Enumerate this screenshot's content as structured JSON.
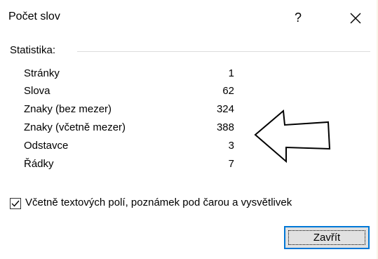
{
  "dialog": {
    "title": "Počet slov",
    "help_label": "?",
    "close_icon": "close-icon"
  },
  "statistics": {
    "group_label": "Statistika:",
    "rows": [
      {
        "label": "Stránky",
        "value": "1"
      },
      {
        "label": "Slova",
        "value": "62"
      },
      {
        "label": "Znaky (bez mezer)",
        "value": "324"
      },
      {
        "label": "Znaky (včetně mezer)",
        "value": "388"
      },
      {
        "label": "Odstavce",
        "value": "3"
      },
      {
        "label": "Řádky",
        "value": "7"
      }
    ]
  },
  "annotation": {
    "icon": "left-arrow-icon"
  },
  "options": {
    "include_label": "Včetně textových polí, poznámek pod čarou a vysvětlivek",
    "include_checked": true
  },
  "buttons": {
    "close_label": "Zavřít"
  },
  "colors": {
    "focus_border": "#0078d7",
    "background": "#ffffff",
    "page_background": "#faf5e8"
  }
}
